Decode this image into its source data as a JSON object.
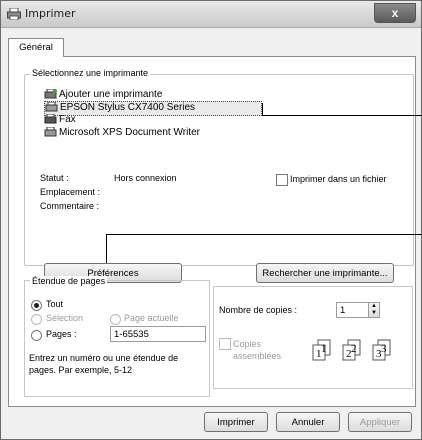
{
  "window": {
    "title": "Imprimer",
    "close_label": "x"
  },
  "tabs": [
    {
      "label": "Général"
    }
  ],
  "printer_group": {
    "legend": "Sélectionnez une imprimante",
    "printers": [
      {
        "label": "Ajouter une imprimante",
        "icon": "add-printer-icon"
      },
      {
        "label": "EPSON Stylus CX7400 Series",
        "icon": "printer-icon",
        "selected": true
      },
      {
        "label": "Fax",
        "icon": "fax-icon"
      },
      {
        "label": "Microsoft XPS Document Writer",
        "icon": "printer-icon"
      }
    ],
    "status_label": "Statut :",
    "status_value": "Hors connexion",
    "location_label": "Emplacement :",
    "comment_label": "Commentaire :",
    "print_to_file_label": "Imprimer dans un fichier",
    "preferences_button": "Préférences",
    "find_printer_button": "Rechercher une imprimante..."
  },
  "page_range": {
    "legend": "Étendue de pages",
    "all_label": "Tout",
    "selection_label": "Sélection",
    "current_page_label": "Page actuelle",
    "pages_label": "Pages :",
    "pages_value": "1-65535",
    "help_text": "Entrez un numéro ou une étendue de pages. Par exemple, 5-12"
  },
  "copies": {
    "count_label": "Nombre de copies :",
    "count_value": "1",
    "collate_label_1": "Copies",
    "collate_label_2": "assemblées",
    "collate_icon_labels": [
      "1",
      "1",
      "2",
      "2",
      "3",
      "3"
    ]
  },
  "footer": {
    "print_button": "Imprimer",
    "cancel_button": "Annuler",
    "apply_button": "Appliquer"
  }
}
